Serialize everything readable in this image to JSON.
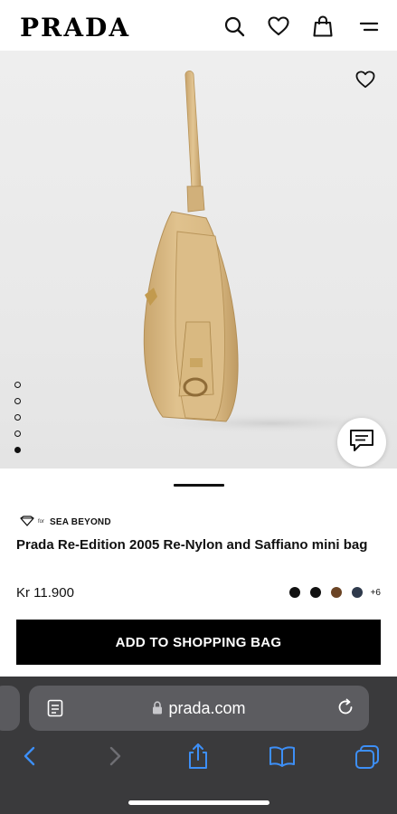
{
  "header": {
    "logo": "PRADA",
    "icons": [
      "search-icon",
      "heart-icon",
      "shopping-bag-icon",
      "menu-icon"
    ]
  },
  "gallery": {
    "image_count": 5,
    "active_index": 4,
    "icons": [
      "heart-icon",
      "chat-icon"
    ]
  },
  "product": {
    "badge_for": "for",
    "badge_brand": "SEA BEYOND",
    "title": "Prada Re-Edition 2005 Re-Nylon and Saffiano mini bag",
    "price": "Kr 11.900",
    "colors": [
      "#111111",
      "#111111",
      "#6b4425",
      "#2f3a4c"
    ],
    "more_colors": "+6",
    "add_button": "ADD TO SHOPPING BAG"
  },
  "browser": {
    "url": "prada.com",
    "colors": {
      "toolbar": "#3a3a3c",
      "urlbar": "#5c5c60",
      "accent": "#3d8ff7"
    },
    "icons": [
      "reader-icon",
      "lock-icon",
      "reload-icon",
      "back-icon",
      "forward-icon",
      "share-icon",
      "bookmarks-icon",
      "tabs-icon"
    ]
  }
}
